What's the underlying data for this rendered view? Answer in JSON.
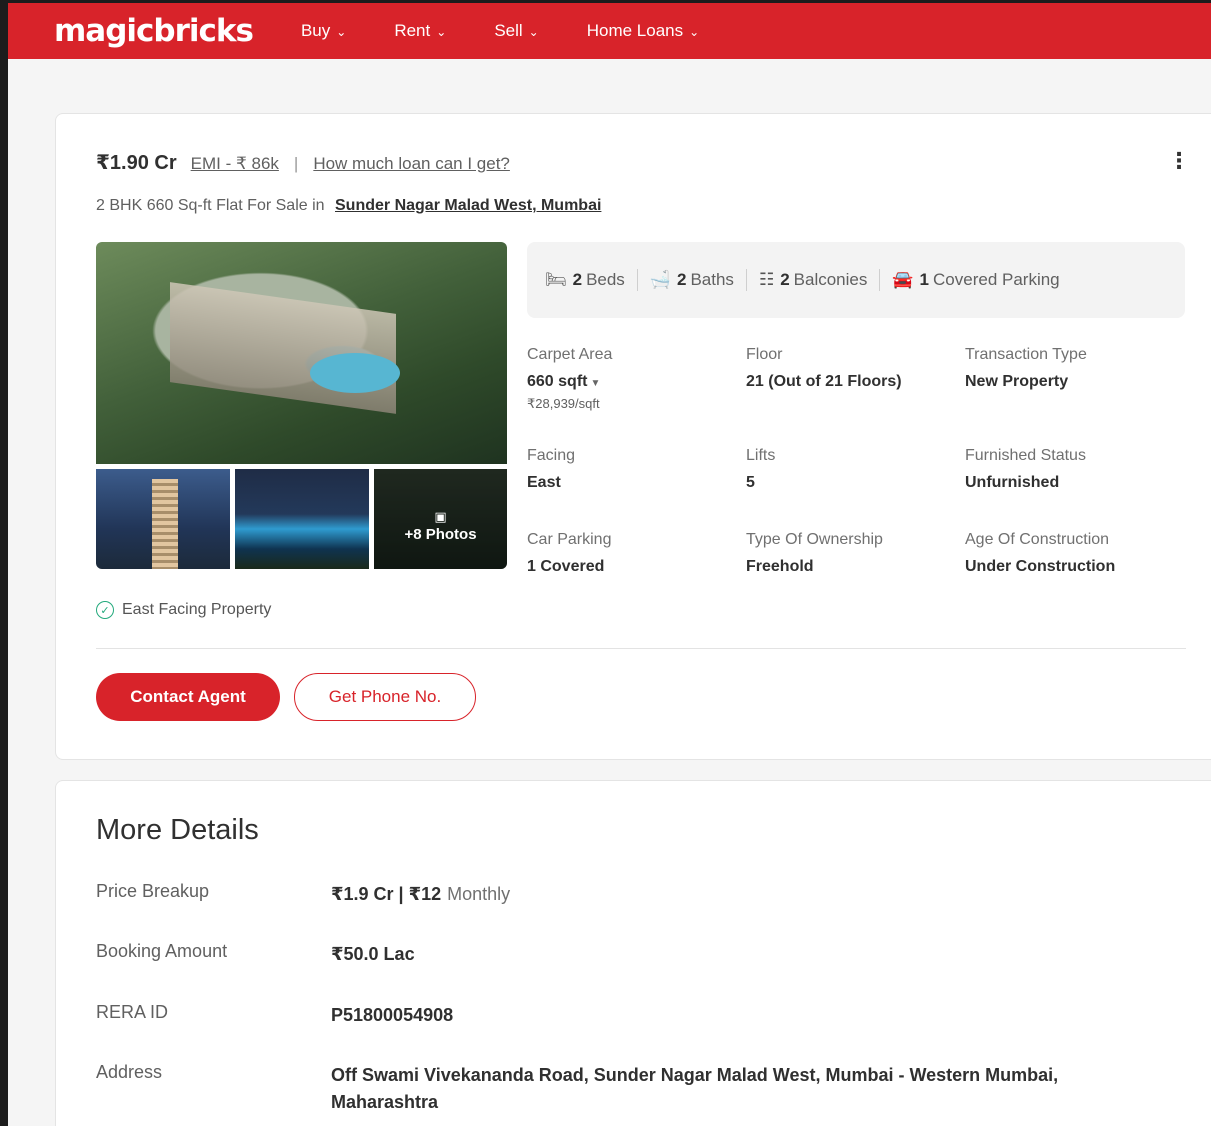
{
  "header": {
    "logo": "magicbricks",
    "nav": [
      {
        "label": "Buy"
      },
      {
        "label": "Rent"
      },
      {
        "label": "Sell"
      },
      {
        "label": "Home Loans"
      }
    ],
    "brand_color": "#d8232a"
  },
  "listing": {
    "price": "₹1.90 Cr",
    "emi": "EMI - ₹ 86k",
    "separator": "|",
    "loan_link": "How much loan can I get?",
    "title_prefix": "2 BHK 660 Sq-ft Flat For Sale in",
    "location": "Sunder Nagar Malad West, Mumbai",
    "photos_more": "+8 Photos",
    "amenities": [
      {
        "icon": "bed-icon",
        "count": "2",
        "label": "Beds"
      },
      {
        "icon": "bath-icon",
        "count": "2",
        "label": "Baths"
      },
      {
        "icon": "balcony-icon",
        "count": "2",
        "label": "Balconies"
      },
      {
        "icon": "car-icon",
        "count": "1",
        "label": "Covered Parking"
      }
    ],
    "details": [
      {
        "label": "Carpet Area",
        "value": "660 sqft",
        "sub": "₹28,939/sqft"
      },
      {
        "label": "Floor",
        "value": "21 (Out of 21 Floors)"
      },
      {
        "label": "Transaction Type",
        "value": "New Property"
      },
      {
        "label": "Facing",
        "value": "East"
      },
      {
        "label": "Lifts",
        "value": "5"
      },
      {
        "label": "Furnished Status",
        "value": "Unfurnished"
      },
      {
        "label": "Car Parking",
        "value": "1 Covered"
      },
      {
        "label": "Type Of Ownership",
        "value": "Freehold"
      },
      {
        "label": "Age Of Construction",
        "value": "Under Construction"
      }
    ],
    "highlight": "East Facing Property",
    "contact_button": "Contact Agent",
    "phone_button": "Get Phone No."
  },
  "more_details": {
    "title": "More Details",
    "rows": [
      {
        "label": "Price Breakup",
        "value": "₹1.9 Cr | ₹12",
        "suffix": "Monthly"
      },
      {
        "label": "Booking Amount",
        "value": "₹50.0 Lac"
      },
      {
        "label": "RERA ID",
        "value": "P51800054908"
      },
      {
        "label": "Address",
        "value": "Off Swami Vivekananda Road, Sunder Nagar Malad West, Mumbai - Western Mumbai, Maharashtra"
      }
    ]
  }
}
